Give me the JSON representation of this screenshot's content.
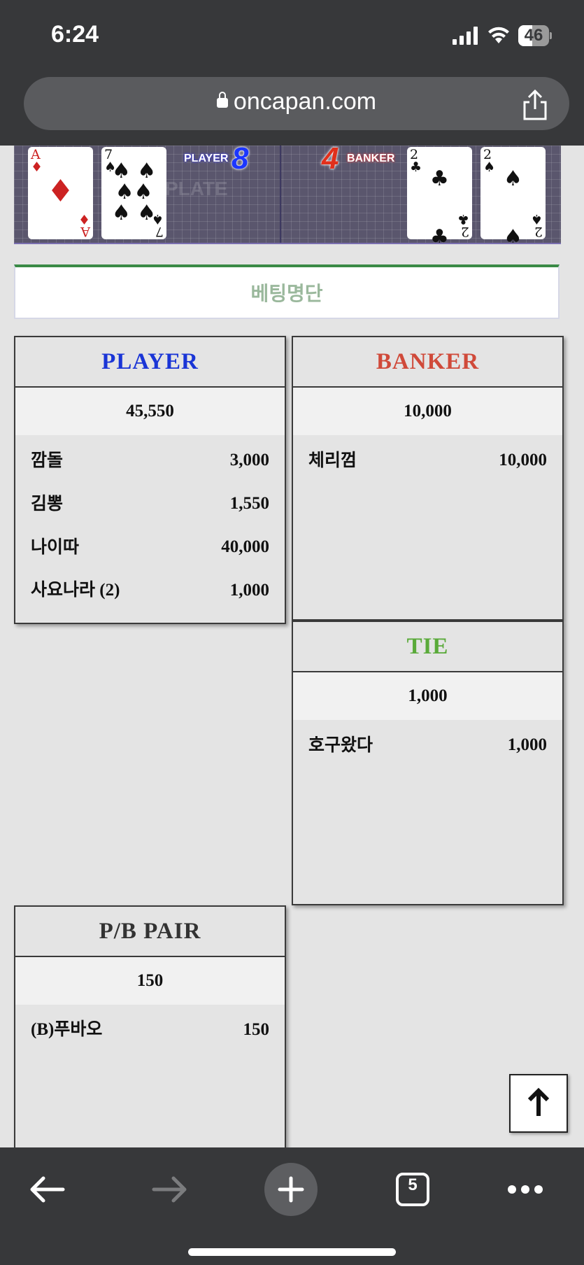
{
  "status_bar": {
    "time": "6:24",
    "battery": "46"
  },
  "browser": {
    "url": "oncapan.com",
    "tab_count": "5"
  },
  "game_board": {
    "player_tag": "PLAYER",
    "player_score": "8",
    "banker_tag": "BANKER",
    "banker_score": "4",
    "plate_text": "PLATE",
    "player_cards": [
      {
        "rank": "A",
        "suit": "♦",
        "color": "#cc2222"
      },
      {
        "rank": "7",
        "suit": "♠",
        "color": "#111111"
      }
    ],
    "banker_cards": [
      {
        "rank": "2",
        "suit": "♣",
        "color": "#111111"
      },
      {
        "rank": "2",
        "suit": "♠",
        "color": "#111111"
      }
    ]
  },
  "bet_list_title": "베팅명단",
  "panels": {
    "player": {
      "title": "PLAYER",
      "color": "#1a35d6",
      "total": "45,550",
      "rows": [
        {
          "name": "깜돌",
          "amount": "3,000"
        },
        {
          "name": "김뽕",
          "amount": "1,550"
        },
        {
          "name": "나이따",
          "amount": "40,000"
        },
        {
          "name": "사요나라 (2)",
          "amount": "1,000"
        }
      ]
    },
    "banker": {
      "title": "BANKER",
      "color": "#d04a3a",
      "total": "10,000",
      "rows": [
        {
          "name": "체리껌",
          "amount": "10,000"
        }
      ]
    },
    "tie": {
      "title": "TIE",
      "color": "#5aaa3a",
      "total": "1,000",
      "rows": [
        {
          "name": "호구왔다",
          "amount": "1,000"
        }
      ]
    },
    "pair": {
      "title": "P/B PAIR",
      "color": "#333333",
      "total": "150",
      "rows": [
        {
          "name": "(B)푸바오",
          "amount": "150"
        }
      ]
    }
  }
}
